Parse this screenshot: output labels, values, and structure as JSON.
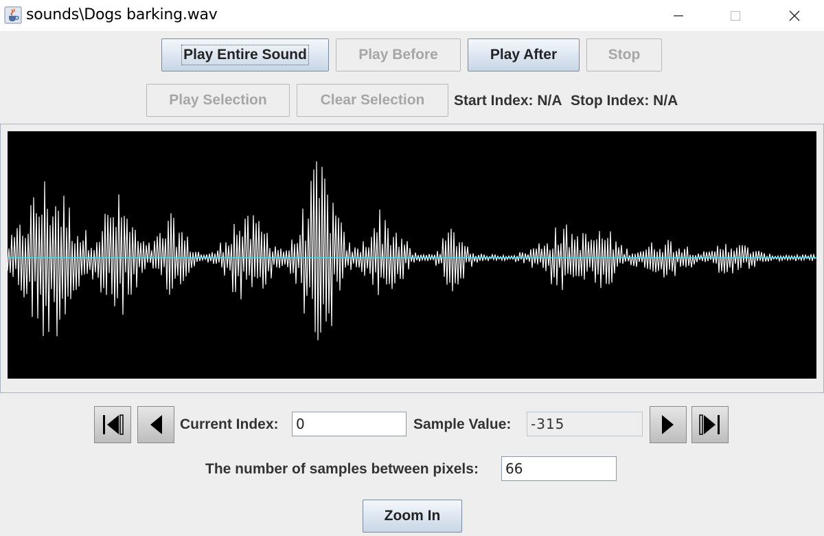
{
  "window": {
    "title": "sounds\\Dogs barking.wav",
    "app_icon": "java-cup-icon",
    "controls": [
      "minimize-icon",
      "maximize-icon",
      "close-icon"
    ]
  },
  "toolbar": {
    "play_entire": "Play Entire Sound",
    "play_before": "Play Before",
    "play_after": "Play After",
    "stop": "Stop",
    "play_selection": "Play Selection",
    "clear_selection": "Clear Selection",
    "start_index": "Start Index: N/A",
    "stop_index": "Stop Index: N/A"
  },
  "waveform": {
    "background": "#000000",
    "wave_color": "#ffffff",
    "center_line_color": "#00ffff"
  },
  "navigation": {
    "current_index_label": "Current Index:",
    "current_index_value": "0",
    "sample_value_label": "Sample Value:",
    "sample_value": "-315"
  },
  "zoom": {
    "samples_label": "The number of samples between pixels:",
    "samples_value": "66",
    "zoom_in": "Zoom In"
  }
}
